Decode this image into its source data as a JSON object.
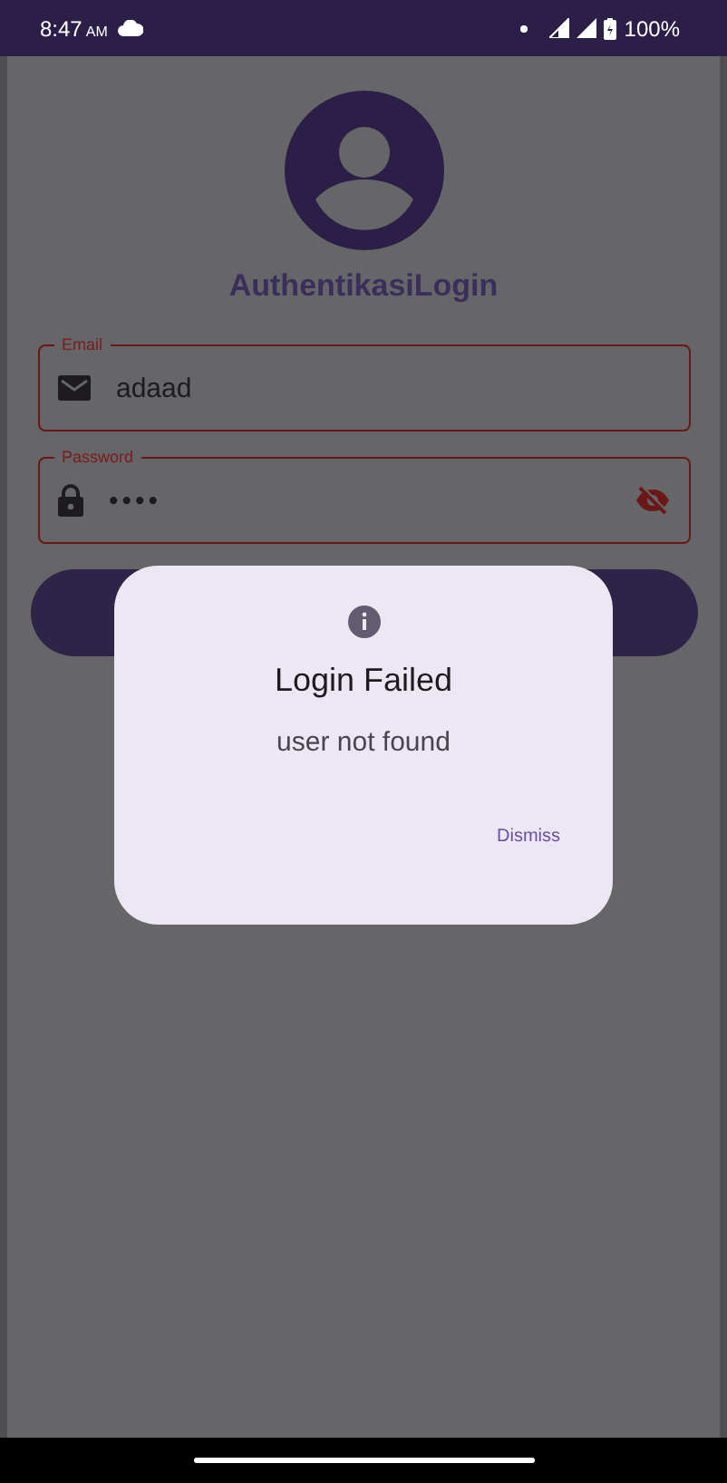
{
  "status_bar": {
    "time": "8:47",
    "time_suffix": "AM",
    "battery": "100%"
  },
  "app": {
    "title": "AuthentikasiLogin"
  },
  "fields": [
    {
      "kind": "email",
      "label": "Email",
      "value": "adaad",
      "error": true
    },
    {
      "kind": "password",
      "label": "Password",
      "value": "••••",
      "error": true
    }
  ],
  "dialog": {
    "title": "Login Failed",
    "message": "user not found",
    "buttons": [
      "Dismiss"
    ]
  }
}
